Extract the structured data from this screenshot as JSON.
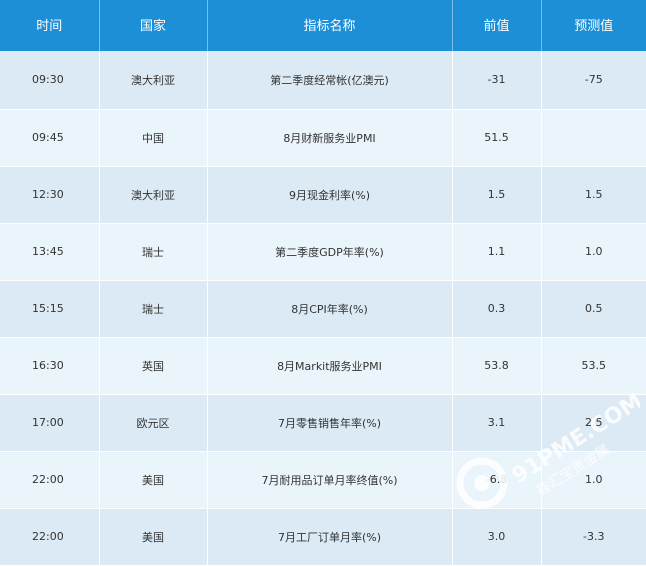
{
  "headers": [
    "时间",
    "国家",
    "指标名称",
    "前值",
    "预测值"
  ],
  "rows": [
    {
      "time": "09:30",
      "country": "澳大利亚",
      "indicator": "第二季度经常帐(亿澳元)",
      "previous": "-31",
      "forecast": "-75"
    },
    {
      "time": "09:45",
      "country": "中国",
      "indicator": "8月财新服务业PMI",
      "previous": "51.5",
      "forecast": ""
    },
    {
      "time": "12:30",
      "country": "澳大利亚",
      "indicator": "9月现金利率(%)",
      "previous": "1.5",
      "forecast": "1.5"
    },
    {
      "time": "13:45",
      "country": "瑞士",
      "indicator": "第二季度GDP年率(%)",
      "previous": "1.1",
      "forecast": "1.0"
    },
    {
      "time": "15:15",
      "country": "瑞士",
      "indicator": "8月CPI年率(%)",
      "previous": "0.3",
      "forecast": "0.5"
    },
    {
      "time": "16:30",
      "country": "英国",
      "indicator": "8月Markit服务业PMI",
      "previous": "53.8",
      "forecast": "53.5"
    },
    {
      "time": "17:00",
      "country": "欧元区",
      "indicator": "7月零售销售年率(%)",
      "previous": "3.1",
      "forecast": "2.5"
    },
    {
      "time": "22:00",
      "country": "美国",
      "indicator": "7月耐用品订单月率终值(%)",
      "previous": "-6.8",
      "forecast": "1.0"
    },
    {
      "time": "22:00",
      "country": "美国",
      "indicator": "7月工厂订单月率(%)",
      "previous": "3.0",
      "forecast": "-3.3"
    }
  ],
  "watermark": {
    "brand": "91PME.COM",
    "tagline": "鑫汇宝贵金属",
    "icon": "logo-ring-icon"
  },
  "colors": {
    "header_bg": "#1d8fd6",
    "row_odd": "#dbeaf5",
    "row_even": "#eaf4fb"
  }
}
